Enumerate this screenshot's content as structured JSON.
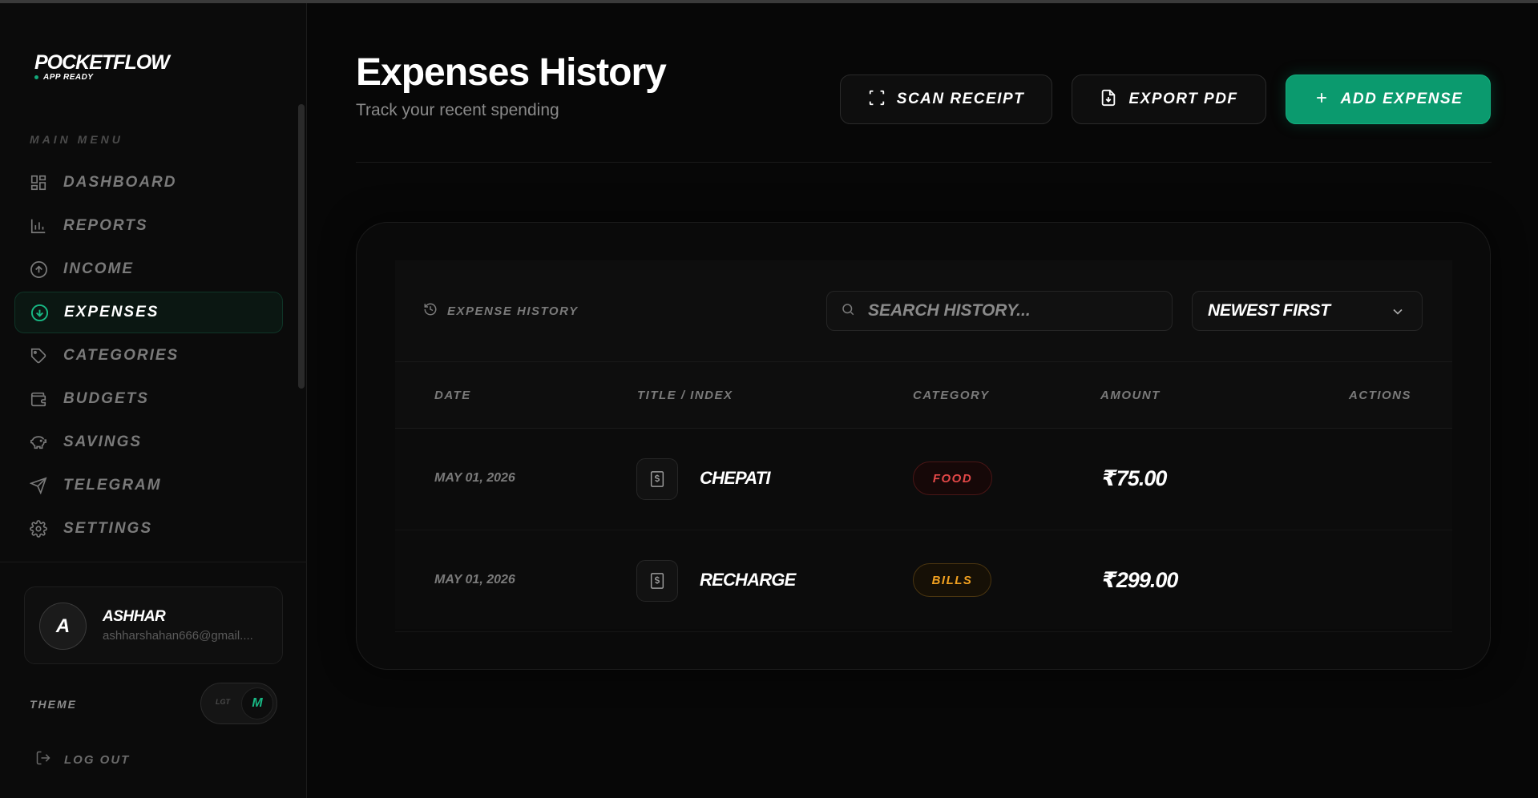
{
  "brand": {
    "title": "POCKETFLOW",
    "subtitle": "APP READY",
    "accent": "#0b9a6e"
  },
  "sidebar": {
    "menu_title": "MAIN MENU",
    "items": [
      {
        "label": "DASHBOARD",
        "icon": "grid-icon"
      },
      {
        "label": "REPORTS",
        "icon": "bar-chart-icon"
      },
      {
        "label": "INCOME",
        "icon": "arrow-up-circle-icon"
      },
      {
        "label": "EXPENSES",
        "icon": "arrow-down-circle-icon",
        "active": true
      },
      {
        "label": "CATEGORIES",
        "icon": "tag-icon"
      },
      {
        "label": "BUDGETS",
        "icon": "wallet-icon"
      },
      {
        "label": "SAVINGS",
        "icon": "piggy-bank-icon"
      },
      {
        "label": "TELEGRAM",
        "icon": "send-icon"
      },
      {
        "label": "SETTINGS",
        "icon": "gear-icon"
      }
    ],
    "user": {
      "initial": "A",
      "name": "ASHHAR",
      "email": "ashharshahan666@gmail...."
    },
    "theme": {
      "label": "THEME",
      "off_label": "LGT",
      "on_label": "M"
    },
    "logout_label": "LOG OUT"
  },
  "header": {
    "title": "Expenses History",
    "subtitle": "Track your recent spending",
    "buttons": {
      "scan": "SCAN RECEIPT",
      "export": "EXPORT PDF",
      "add": "ADD EXPENSE"
    }
  },
  "table": {
    "section_label": "EXPENSE HISTORY",
    "search_placeholder": "SEARCH HISTORY...",
    "sort_value": "NEWEST FIRST",
    "columns": [
      "DATE",
      "TITLE / INDEX",
      "CATEGORY",
      "AMOUNT",
      "ACTIONS"
    ],
    "rows": [
      {
        "date": "MAY 01, 2026",
        "title": "CHEPATI",
        "category": "FOOD",
        "amount": "₹75.00"
      },
      {
        "date": "MAY 01, 2026",
        "title": "RECHARGE",
        "category": "BILLS",
        "amount": "₹299.00"
      }
    ]
  }
}
